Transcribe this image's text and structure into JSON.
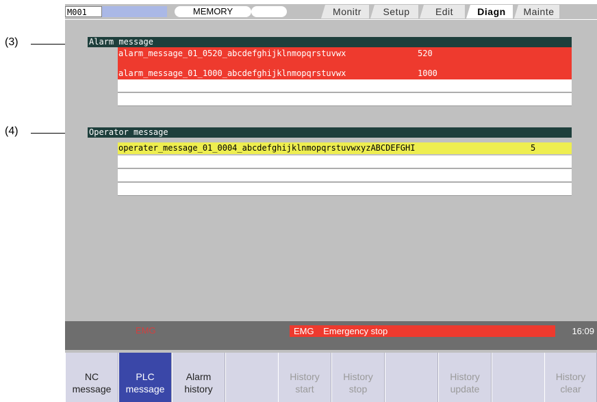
{
  "topbar": {
    "screen_id": "M001",
    "mode": "MEMORY",
    "tabs": [
      {
        "label": "Monitr",
        "active": false
      },
      {
        "label": "Setup",
        "active": false
      },
      {
        "label": "Edit",
        "active": false
      },
      {
        "label": "Diagn",
        "active": true
      },
      {
        "label": "Mainte",
        "active": false
      }
    ]
  },
  "callouts": {
    "c3": "(3)",
    "c4": "(4)"
  },
  "alarm": {
    "title": "Alarm message",
    "rows": [
      {
        "text": "alarm_message_01_0520_abcdefghijklnmopqrstuvwx",
        "num": "520"
      },
      {
        "text": "alarm_message_01_1000_abcdefghijklnmopqrstuvwx",
        "num": "1000"
      }
    ]
  },
  "operator": {
    "title": "Operator message",
    "rows": [
      {
        "text": "operater_message_01_0004_abcdefghijklnmopqrstuvwxyzABCDEFGHI",
        "num": "5"
      }
    ]
  },
  "status": {
    "emg_small": "EMG",
    "emg_label": "EMG",
    "emg_message": "Emergency stop",
    "time": "16:09"
  },
  "menu": [
    {
      "line1": "NC",
      "line2": "message"
    },
    {
      "line1": "PLC",
      "line2": "message"
    },
    {
      "line1": "Alarm",
      "line2": "history"
    },
    {
      "line1": "",
      "line2": ""
    },
    {
      "line1": "History",
      "line2": "start"
    },
    {
      "line1": "History",
      "line2": "stop"
    },
    {
      "line1": "",
      "line2": ""
    },
    {
      "line1": "History",
      "line2": "update"
    },
    {
      "line1": "",
      "line2": ""
    },
    {
      "line1": "History",
      "line2": "clear"
    }
  ],
  "colors": {
    "alarm_row": "#ee3a2e",
    "operator_row": "#eeee50",
    "header_bg": "#1e3f3c",
    "active_menu": "#3a47a8"
  }
}
